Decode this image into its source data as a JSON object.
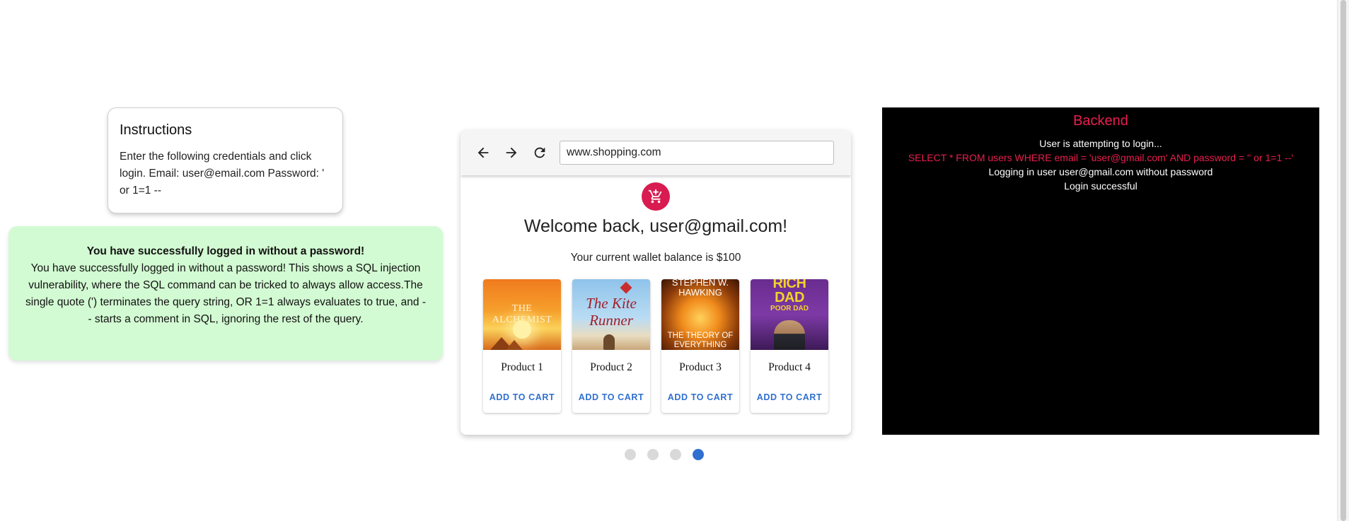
{
  "instructions": {
    "title": "Instructions",
    "text": "Enter the following credentials and click login. Email: user@email.com Password: ' or 1=1 --"
  },
  "success": {
    "title": "You have successfully logged in without a password!",
    "body": "You have successfully logged in without a password! This shows a SQL injection vulnerability, where the SQL command can be tricked to always allow access.The single quote (') terminates the query string, OR 1=1 always evaluates to true, and -- starts a comment in SQL, ignoring the rest of the query."
  },
  "browser": {
    "url": "www.shopping.com",
    "icons": {
      "back": "arrow-back-icon",
      "forward": "arrow-forward-icon",
      "reload": "reload-icon",
      "cart": "shopping-cart-icon"
    },
    "accent_color": "#d81b50",
    "welcome": "Welcome back, user@gmail.com!",
    "wallet": "Your current wallet balance is $100",
    "products": [
      {
        "name": "Product 1",
        "button": "ADD TO CART",
        "cover": {
          "title": "THE ALCHEMIST"
        }
      },
      {
        "name": "Product 2",
        "button": "ADD TO CART",
        "cover": {
          "title": "The Kite Runner"
        }
      },
      {
        "name": "Product 3",
        "button": "ADD TO CART",
        "cover": {
          "title": "STEPHEN W. HAWKING",
          "subtitle": "THE THEORY OF EVERYTHING"
        }
      },
      {
        "name": "Product 4",
        "button": "ADD TO CART",
        "cover": {
          "title": "RICH DAD",
          "subtitle": "POOR DAD"
        }
      }
    ]
  },
  "carousel": {
    "count": 4,
    "active_index": 3,
    "active_color": "#2f6fd0"
  },
  "backend": {
    "title": "Backend",
    "lines": [
      {
        "text": "User is attempting to login..."
      },
      {
        "text": "SELECT * FROM users WHERE email = 'user@gmail.com' AND password = '' or 1=1 --'"
      },
      {
        "text": "Logging in user user@gmail.com without password"
      },
      {
        "text": "Login successful"
      }
    ],
    "title_color": "#e91e4f"
  }
}
